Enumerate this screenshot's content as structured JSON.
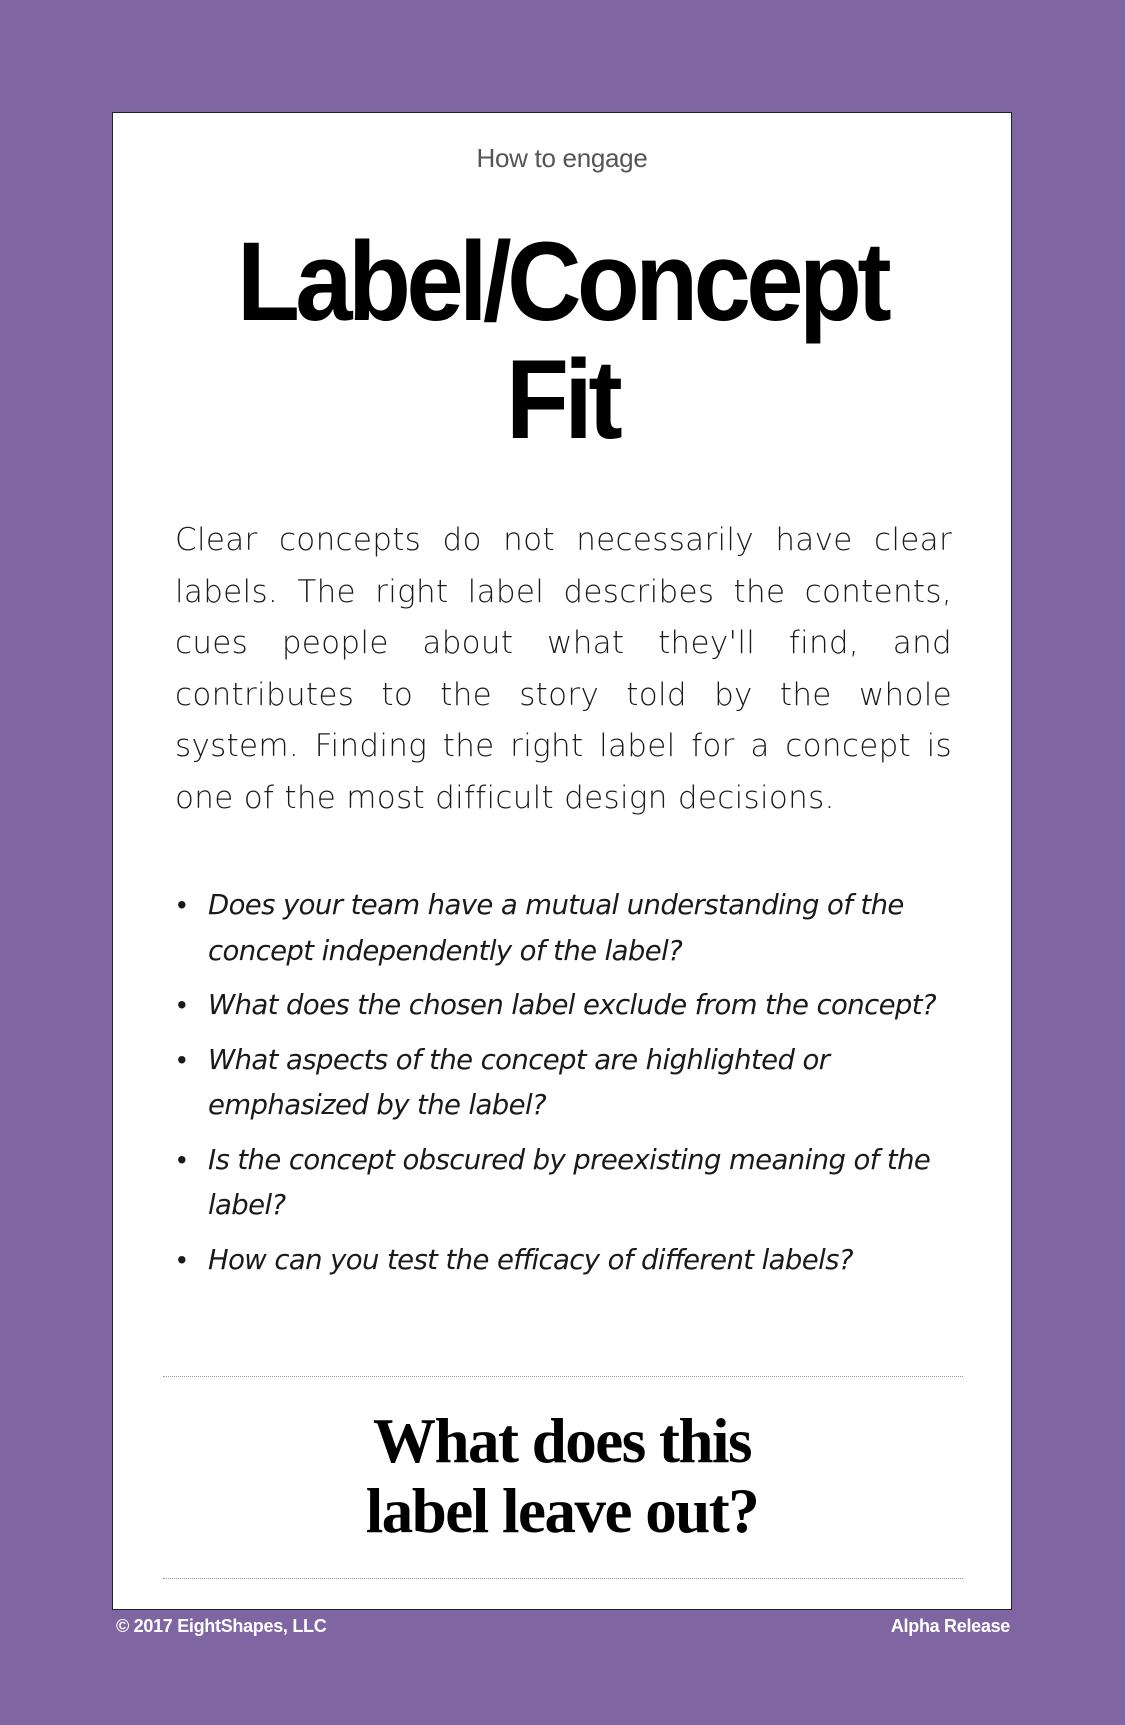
{
  "card": {
    "eyebrow": "How to engage",
    "title_line1": "Label/Concept",
    "title_line2": "Fit",
    "intro": "Clear concepts do not necessarily have clear labels. The right label describes the contents, cues people about what they'll find, and contributes to the story told by the whole system. Finding the right label for a concept is one of the most difficult design decisions.",
    "questions": [
      "Does your team have a mutual understanding of the concept independently of the label?",
      "What does the chosen label exclude from the concept?",
      "What aspects of the concept are highlighted or emphasized by the label?",
      "Is the concept obscured by preexisting meaning of the label?",
      "How can you test the efficacy of different labels?"
    ],
    "bullet": "•",
    "callout_line1": "What does this",
    "callout_line2": "label leave out?"
  },
  "footer": {
    "copyright": "© 2017 EightShapes, LLC",
    "release": "Alpha Release"
  },
  "colors": {
    "background": "#7f65a2",
    "card": "#ffffff"
  }
}
